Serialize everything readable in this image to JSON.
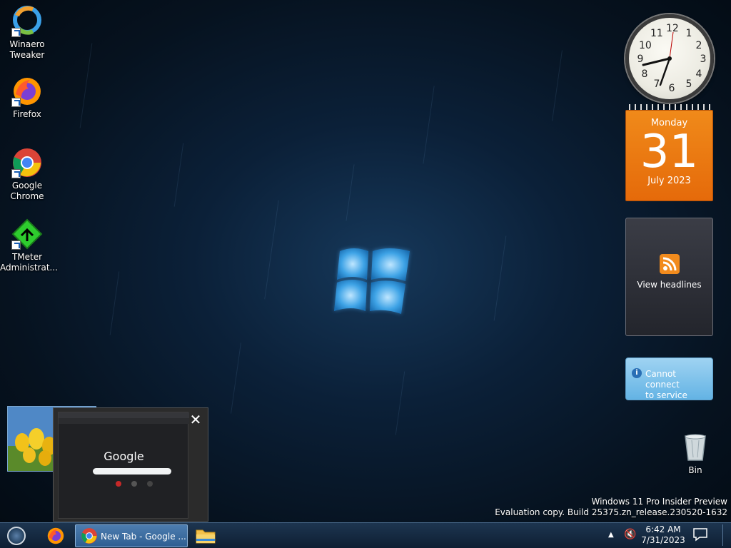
{
  "desktop_icons": [
    {
      "label": "Winaero Tweaker",
      "icon": "winaero-tweaker-icon"
    },
    {
      "label": "Firefox",
      "icon": "firefox-icon"
    },
    {
      "label": "Google Chrome",
      "icon": "chrome-icon"
    },
    {
      "label": "TMeter Administrat...",
      "icon": "tmeter-icon"
    }
  ],
  "gadgets": {
    "clock": {
      "numbers": [
        "12",
        "1",
        "2",
        "3",
        "4",
        "5",
        "6",
        "7",
        "8",
        "9",
        "10",
        "11"
      ]
    },
    "calendar": {
      "weekday": "Monday",
      "day": "31",
      "month_year": "July 2023"
    },
    "feed": {
      "label": "View headlines",
      "icon": "rss-feed-icon"
    },
    "weather": {
      "message_line1": "Cannot connect",
      "message_line2": "to service",
      "icon": "info-icon"
    }
  },
  "recycle_bin": {
    "label": "Bin",
    "icon": "recycle-bin-icon"
  },
  "watermark": {
    "line1": "Windows 11 Pro Insider Preview",
    "line2": "Evaluation copy. Build 25375.zn_release.230520-1632"
  },
  "thumbnail": {
    "close_glyph": "✕",
    "page_title": "Google"
  },
  "taskbar": {
    "start_icon": "start-orb-icon",
    "firefox_icon": "firefox-icon",
    "chrome_task_label": "New Tab - Google ...",
    "explorer_icon": "file-explorer-icon",
    "tray_chevron": "▲",
    "volume_glyph": "🔇",
    "time": "6:42 AM",
    "date": "7/31/2023",
    "notification_icon": "action-center-icon"
  },
  "colors": {
    "calendar_orange": "#e8740f",
    "taskbar_dark": "#0e1f33",
    "weather_blue": "#63b3e4"
  }
}
